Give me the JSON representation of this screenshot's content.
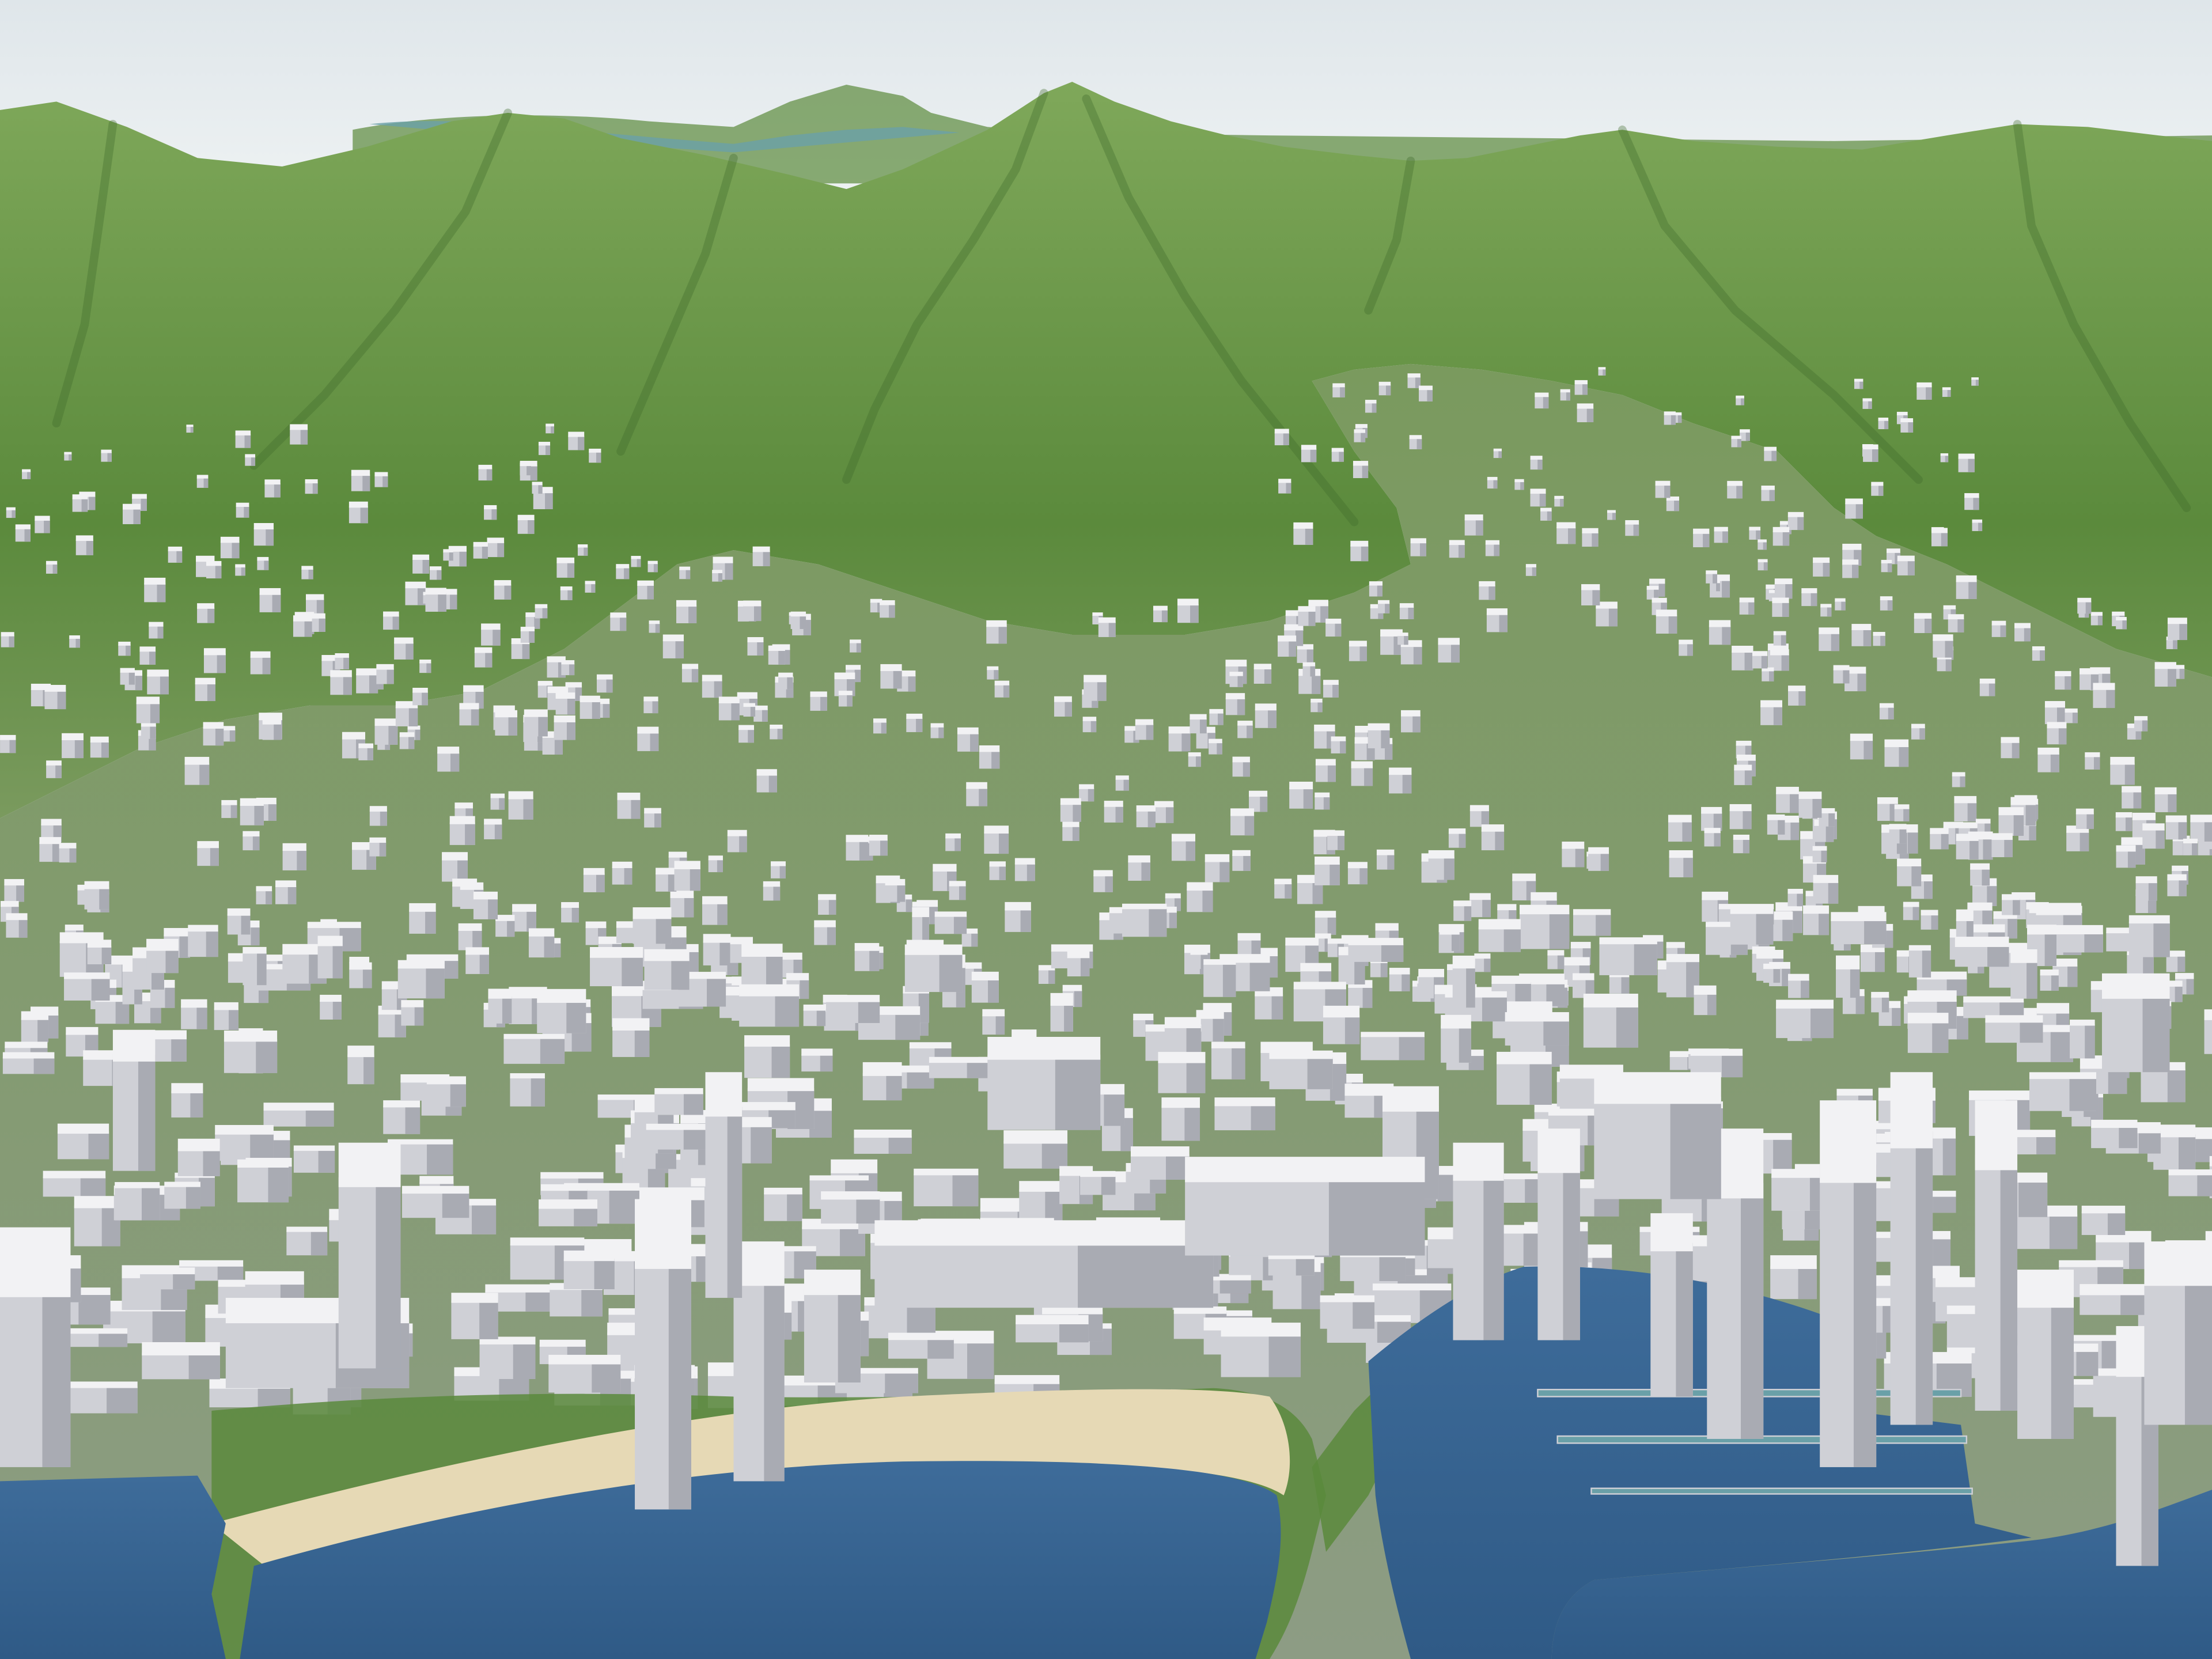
{
  "scene": {
    "kind": "3d-city-terrain-render",
    "colors": {
      "sky": "#dfe6ea",
      "sky_horizon": "#eef2f3",
      "mountain_light": "#7fa85a",
      "mountain_mid": "#5b8a3c",
      "mountain_dark": "#3f6a2a",
      "valley": "#7a9a5e",
      "urban_ground": "#8d9c84",
      "building_top": "#f2f2f4",
      "building_side": "#cfd0d6",
      "building_shadow": "#a9abb3",
      "ocean": "#3e6c9a",
      "ocean_deep": "#2f5a86",
      "beach": "#e6d9b5",
      "shallow_water": "#6aa0a8"
    },
    "regions": [
      "sky",
      "distant-coastline",
      "mountain-range",
      "residential-valleys",
      "downtown-district",
      "harbor-marina",
      "beach-park",
      "ocean-bay"
    ]
  }
}
